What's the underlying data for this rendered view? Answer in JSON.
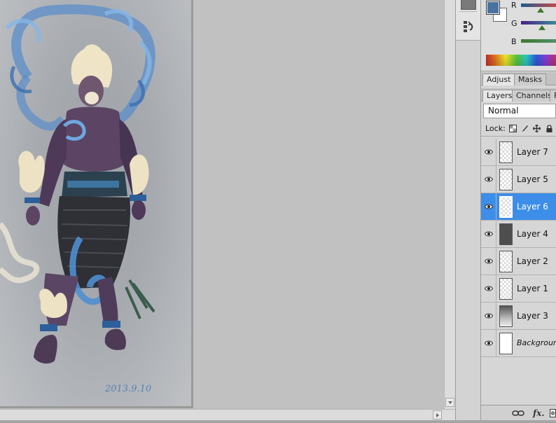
{
  "canvas": {
    "signature_text": "2013.9.10"
  },
  "tools": {
    "icons": [
      "tool-panel-button",
      "history-tool-icon"
    ]
  },
  "color_panel": {
    "foreground": "#4a72a0",
    "background": "#ffffff",
    "channels": [
      {
        "label": "R",
        "thumb_color": "#3b7a2b"
      },
      {
        "label": "G",
        "thumb_color": "#3b7a2b"
      },
      {
        "label": "B",
        "thumb_color": "#3b7a2b"
      }
    ]
  },
  "adjust_tabs": [
    {
      "label": "Adjust",
      "active": true
    },
    {
      "label": "Masks",
      "active": false
    }
  ],
  "layer_tabs": [
    {
      "label": "Layers",
      "active": true
    },
    {
      "label": "Channels",
      "active": false
    },
    {
      "label": "Paths",
      "active": false
    }
  ],
  "blend_mode": "Normal",
  "lock": {
    "label": "Lock:",
    "icons": [
      "lock-transparency-icon",
      "lock-pixels-icon",
      "lock-position-icon",
      "lock-all-icon"
    ]
  },
  "layers": [
    {
      "name": "Layer 7",
      "thumb": "checker",
      "selected": false
    },
    {
      "name": "Layer 5",
      "thumb": "checker",
      "selected": false
    },
    {
      "name": "Layer 6",
      "thumb": "checker",
      "selected": true
    },
    {
      "name": "Layer 4",
      "thumb": "dark",
      "selected": false
    },
    {
      "name": "Layer 2",
      "thumb": "checker",
      "selected": false
    },
    {
      "name": "Layer 1",
      "thumb": "checker",
      "selected": false
    },
    {
      "name": "Layer 3",
      "thumb": "grad",
      "selected": false
    },
    {
      "name": "Background",
      "thumb": "white",
      "selected": false
    }
  ],
  "footer": {
    "link_icon": "link-icon",
    "fx_label": "fx."
  },
  "accent_color": "#3d8ee8"
}
